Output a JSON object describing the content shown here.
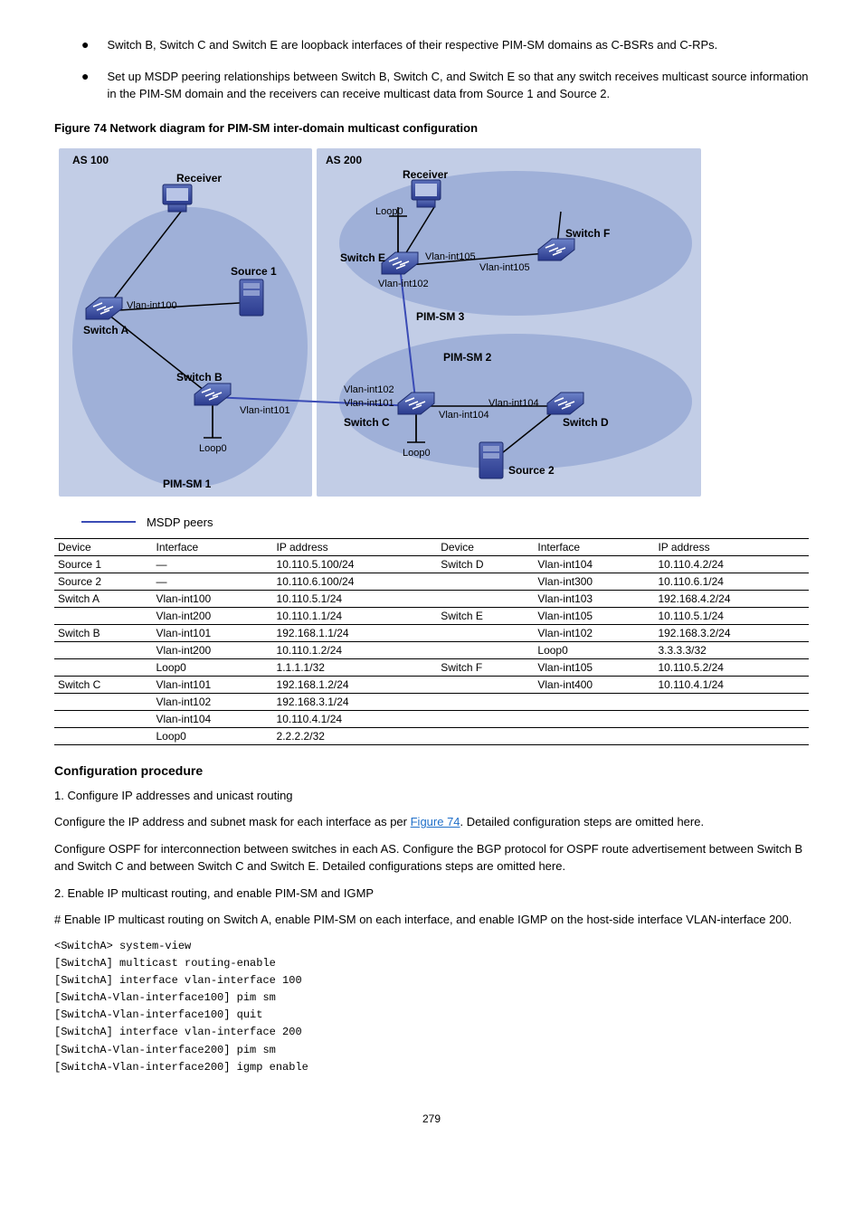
{
  "bullets": [
    "Switch B, Switch C and Switch E are loopback interfaces of their respective PIM-SM domains as C-BSRs and C-RPs.",
    "Set up MSDP peering relationships between Switch B, Switch C, and Switch E so that any switch receives multicast source information in the PIM-SM domain and the receivers can receive multicast data from Source 1 and Source 2."
  ],
  "figureTitle": "Figure 74 Network diagram for PIM-SM inter-domain multicast configuration",
  "legend": "MSDP peers",
  "diagram": {
    "as100": "AS 100",
    "as200": "AS 200",
    "receiver": "Receiver",
    "source1": "Source 1",
    "source2": "Source 2",
    "switchA": "Switch A",
    "switchB": "Switch B",
    "switchC": "Switch C",
    "switchD": "Switch D",
    "switchE": "Switch E",
    "switchF": "Switch F",
    "pimsm1": "PIM-SM 1",
    "pimsm2": "PIM-SM 2",
    "pimsm3": "PIM-SM 3",
    "loop0": "Loop0",
    "vlan100": "Vlan-int100",
    "vlan101": "Vlan-int101",
    "vlan102": "Vlan-int102",
    "vlan104": "Vlan-int104",
    "vlan105": "Vlan-int105"
  },
  "table": {
    "header": [
      "Device",
      "Interface",
      "IP address",
      "Device",
      "Interface",
      "IP address"
    ],
    "rows": [
      [
        "Source 1",
        "—",
        "10.110.5.100/24",
        "Switch D",
        "Vlan-int104",
        "10.110.4.2/24"
      ],
      [
        "Source 2",
        "—",
        "10.110.6.100/24",
        "",
        "Vlan-int300",
        "10.110.6.1/24"
      ],
      [
        "Switch A",
        "Vlan-int100",
        "10.110.5.1/24",
        "",
        "Vlan-int103",
        "192.168.4.2/24"
      ],
      [
        "",
        "Vlan-int200",
        "10.110.1.1/24",
        "Switch E",
        "Vlan-int105",
        "10.110.5.1/24"
      ],
      [
        "Switch B",
        "Vlan-int101",
        "192.168.1.1/24",
        "",
        "Vlan-int102",
        "192.168.3.2/24"
      ],
      [
        "",
        "Vlan-int200",
        "10.110.1.2/24",
        "",
        "Loop0",
        "3.3.3.3/32"
      ],
      [
        "",
        "Loop0",
        "1.1.1.1/32",
        "Switch F",
        "Vlan-int105",
        "10.110.5.2/24"
      ],
      [
        "Switch C",
        "Vlan-int101",
        "192.168.1.2/24",
        "",
        "Vlan-int400",
        "10.110.4.1/24"
      ],
      [
        "",
        "Vlan-int102",
        "192.168.3.1/24",
        "",
        "",
        ""
      ],
      [
        "",
        "Vlan-int104",
        "10.110.4.1/24",
        "",
        "",
        ""
      ],
      [
        "",
        "Loop0",
        "2.2.2.2/32",
        "",
        "",
        ""
      ]
    ]
  },
  "procedure": {
    "title": "Configuration procedure",
    "step1": "1.   Configure IP addresses and unicast routing",
    "para1a": "Configure the IP address and subnet mask for each interface as per ",
    "para1link": "Figure 74",
    "para1b": ". Detailed configuration steps are omitted here.",
    "para2": "Configure OSPF for interconnection between switches in each AS. Configure the BGP protocol for OSPF route advertisement between Switch B and Switch C and between Switch C and Switch E. Detailed configurations steps are omitted here.",
    "step2": "2.   Enable IP multicast routing, and enable PIM-SM and IGMP",
    "commentA": "# Enable IP multicast routing on Switch A, enable PIM-SM on each interface, and enable IGMP on the host-side interface VLAN-interface 200.",
    "cmds": [
      "<SwitchA> system-view",
      "[SwitchA] multicast routing-enable",
      "[SwitchA] interface vlan-interface 100",
      "[SwitchA-Vlan-interface100] pim sm",
      "[SwitchA-Vlan-interface100] quit",
      "[SwitchA] interface vlan-interface 200",
      "[SwitchA-Vlan-interface200] pim sm",
      "[SwitchA-Vlan-interface200] igmp enable"
    ]
  },
  "pageNumber": "279"
}
